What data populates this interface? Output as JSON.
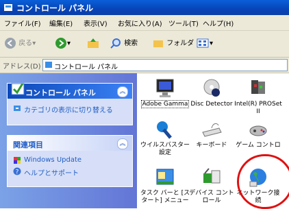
{
  "window": {
    "title": "コントロール パネル"
  },
  "menu": [
    "ファイル(F)",
    "編集(E)",
    "表示(V)",
    "お気に入り(A)",
    "ツール(T)",
    "ヘルプ(H)"
  ],
  "toolbar": {
    "back": "戻る",
    "search": "検索",
    "folders": "フォルダ"
  },
  "address": {
    "label": "アドレス(D)",
    "value": "コントロール パネル"
  },
  "sidebar": {
    "panel1": {
      "title": "コントロール パネル",
      "link": "カテゴリの表示に切り替える"
    },
    "panel2": {
      "title": "関連項目",
      "links": [
        "Windows Update",
        "ヘルプとサポート"
      ]
    }
  },
  "items": [
    {
      "label": "Adobe Gamma"
    },
    {
      "label": "Disc Detector"
    },
    {
      "label": "Intel(R) PROSet II"
    },
    {
      "label": "ウイルスバスター 設定"
    },
    {
      "label": "キーボード"
    },
    {
      "label": "ゲーム コントロ"
    },
    {
      "label": "タスク バーと [ス タート] メニュー"
    },
    {
      "label": "デバイス コントロール"
    },
    {
      "label": "ネットワーク接 続"
    }
  ]
}
